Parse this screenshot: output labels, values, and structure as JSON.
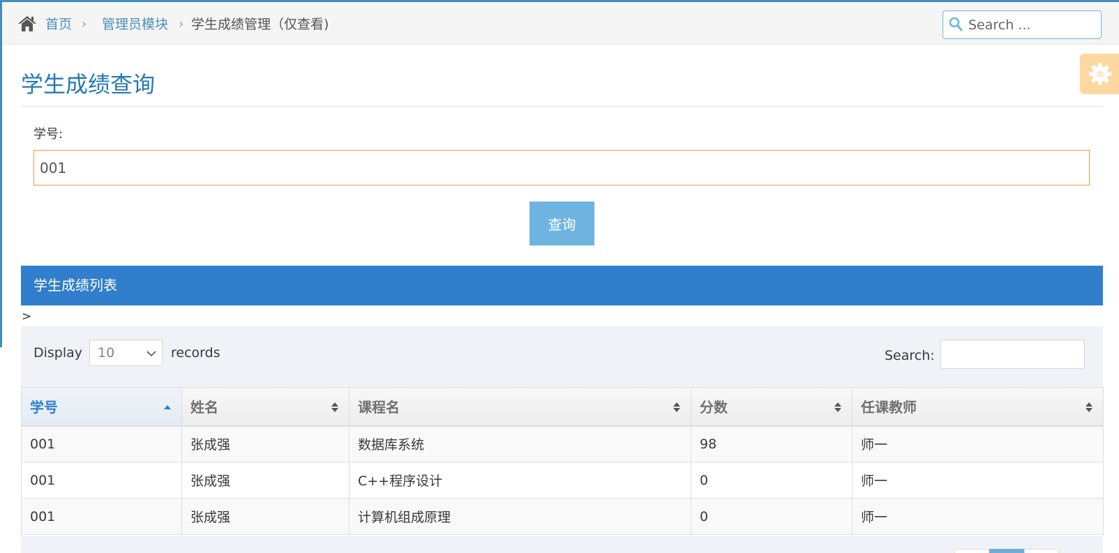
{
  "breadcrumb": {
    "home": "首页",
    "module": "管理员模块",
    "current": "学生成绩管理（仅查看)"
  },
  "nav_search": {
    "placeholder": "Search ..."
  },
  "page": {
    "title": "学生成绩查询"
  },
  "form": {
    "student_id_label": "学号:",
    "student_id_value": "001",
    "query_button": "查询"
  },
  "panel": {
    "title": "学生成绩列表",
    "stray_text": ">"
  },
  "table_controls": {
    "display_label": "Display",
    "page_length": "10",
    "records_label": "records",
    "search_label": "Search:"
  },
  "table": {
    "columns": [
      "学号",
      "姓名",
      "课程名",
      "分数",
      "任课教师"
    ],
    "sorted_column": 0,
    "rows": [
      [
        "001",
        "张成强",
        "数据库系统",
        "98",
        "师一"
      ],
      [
        "001",
        "张成强",
        "C++程序设计",
        "0",
        "师一"
      ],
      [
        "001",
        "张成强",
        "计算机组成原理",
        "0",
        "师一"
      ]
    ]
  },
  "colors": {
    "accent": "#438eb9",
    "header_blue": "#307ecc",
    "button_blue": "#6fb3e0",
    "input_focus_orange": "#f59942",
    "settings_orange": "#ffb752"
  },
  "icons": [
    "home-icon",
    "chevron-right-icon",
    "search-icon",
    "gear-icon",
    "chevron-down-icon",
    "sort-asc-icon",
    "sort-both-icon"
  ]
}
